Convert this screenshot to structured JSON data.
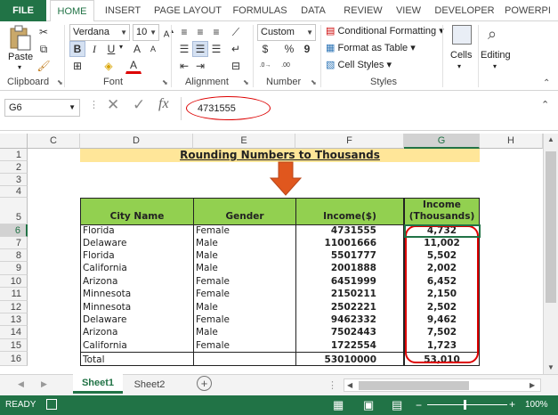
{
  "ribbon_tabs": [
    "FILE",
    "HOME",
    "INSERT",
    "PAGE LAYOUT",
    "FORMULAS",
    "DATA",
    "REVIEW",
    "VIEW",
    "DEVELOPER",
    "POWERPI"
  ],
  "clipboard": {
    "paste_label": "Paste",
    "group_label": "Clipboard"
  },
  "font": {
    "name": "Verdana",
    "size": "10",
    "group_label": "Font",
    "bold": "B",
    "italic": "I",
    "underline": "U",
    "font_color_glyph": "A"
  },
  "alignment": {
    "group_label": "Alignment"
  },
  "number": {
    "format": "Custom",
    "group_label": "Number",
    "dollar": "$",
    "percent": "%",
    "comma": "9"
  },
  "styles": {
    "conditional_formatting": "Conditional Formatting",
    "format_as_table": "Format as Table",
    "cell_styles": "Cell Styles",
    "group_label": "Styles"
  },
  "cells": {
    "label": "Cells"
  },
  "editing": {
    "label": "Editing"
  },
  "formula_bar": {
    "name_box": "G6",
    "fx_label": "fx",
    "value": "4731555"
  },
  "columns": [
    "C",
    "D",
    "E",
    "F",
    "G",
    "H"
  ],
  "rows": [
    "1",
    "2",
    "3",
    "4",
    "5",
    "6",
    "7",
    "8",
    "9",
    "10",
    "11",
    "12",
    "13",
    "14",
    "15",
    "16"
  ],
  "sheet": {
    "title": "Rounding Numbers to Thousands",
    "headers": [
      "City Name",
      "Gender",
      "Income($)",
      "Income (Thousands)"
    ],
    "data_rows": [
      [
        "Florida",
        "Female",
        "4731555",
        "4,732"
      ],
      [
        "Delaware",
        "Male",
        "11001666",
        "11,002"
      ],
      [
        "Florida",
        "Male",
        "5501777",
        "5,502"
      ],
      [
        "California",
        "Male",
        "2001888",
        "2,002"
      ],
      [
        "Arizona",
        "Female",
        "6451999",
        "6,452"
      ],
      [
        "Minnesota",
        "Female",
        "2150211",
        "2,150"
      ],
      [
        "Minnesota",
        "Male",
        "2502221",
        "2,502"
      ],
      [
        "Delaware",
        "Female",
        "9462332",
        "9,462"
      ],
      [
        "Arizona",
        "Male",
        "7502443",
        "7,502"
      ],
      [
        "California",
        "Female",
        "1722554",
        "1,723"
      ]
    ],
    "total_row": [
      "Total",
      "",
      "53010000",
      "53,010"
    ]
  },
  "sheet_tabs": [
    "Sheet1",
    "Sheet2"
  ],
  "status": {
    "mode": "READY",
    "zoom": "100%"
  },
  "colors": {
    "excel_green": "#217346",
    "header_green": "#92d050",
    "title_yellow": "#ffe699",
    "arrow_orange": "#e0571e",
    "highlight_red": "#d00000"
  }
}
